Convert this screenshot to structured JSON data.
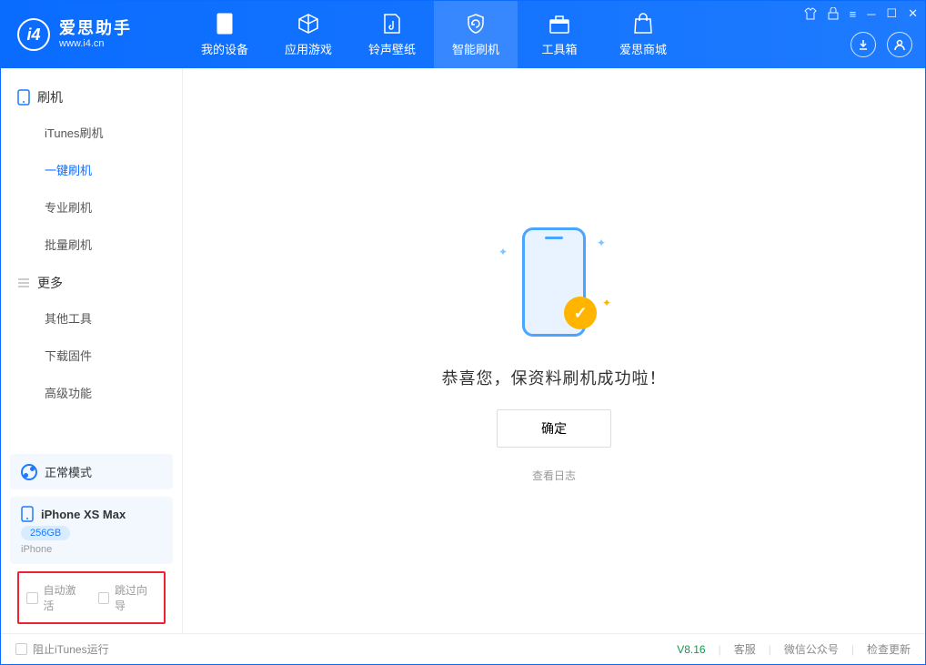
{
  "app": {
    "name_cn": "爱思助手",
    "name_en": "www.i4.cn"
  },
  "nav": [
    {
      "label": "我的设备"
    },
    {
      "label": "应用游戏"
    },
    {
      "label": "铃声壁纸"
    },
    {
      "label": "智能刷机"
    },
    {
      "label": "工具箱"
    },
    {
      "label": "爱思商城"
    }
  ],
  "sidebar": {
    "group1": {
      "title": "刷机",
      "items": [
        "iTunes刷机",
        "一键刷机",
        "专业刷机",
        "批量刷机"
      ]
    },
    "group2": {
      "title": "更多",
      "items": [
        "其他工具",
        "下载固件",
        "高级功能"
      ]
    },
    "mode": "正常模式",
    "device": {
      "name": "iPhone XS Max",
      "storage": "256GB",
      "type": "iPhone"
    },
    "checkbox1": "自动激活",
    "checkbox2": "跳过向导"
  },
  "main": {
    "success": "恭喜您，保资料刷机成功啦！",
    "ok": "确定",
    "log": "查看日志"
  },
  "status": {
    "block_itunes": "阻止iTunes运行",
    "version": "V8.16",
    "links": [
      "客服",
      "微信公众号",
      "检查更新"
    ]
  }
}
